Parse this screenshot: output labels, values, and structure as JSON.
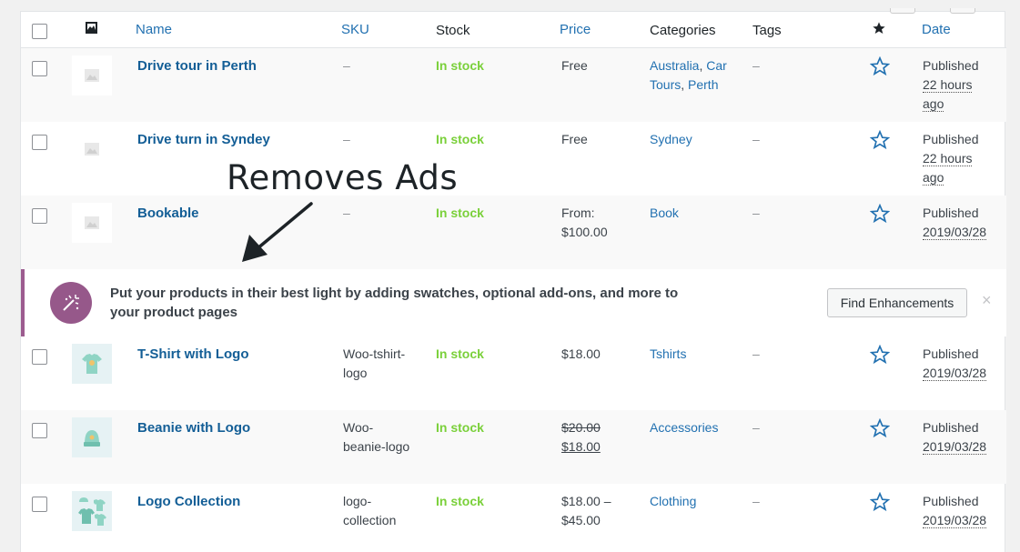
{
  "header": {
    "columns": {
      "name": "Name",
      "sku": "SKU",
      "stock": "Stock",
      "price": "Price",
      "categories": "Categories",
      "tags": "Tags",
      "date": "Date"
    },
    "icons": [
      "image-icon",
      "star-filled-icon"
    ]
  },
  "rows": [
    {
      "name": "Drive tour in Perth",
      "sku": "–",
      "stock": "In stock",
      "price_line1": "Free",
      "price_line2": "",
      "categories": [
        "Australia",
        "Car Tours",
        "Perth"
      ],
      "tags": "–",
      "status": "Published",
      "date_line1": "22 hours",
      "date_line2": "ago"
    },
    {
      "name": "Drive turn in Syndey",
      "sku": "–",
      "stock": "In stock",
      "price_line1": "Free",
      "price_line2": "",
      "categories": [
        "Sydney"
      ],
      "tags": "–",
      "status": "Published",
      "date_line1": "22 hours",
      "date_line2": "ago"
    },
    {
      "name": "Bookable",
      "sku": "–",
      "stock": "In stock",
      "price_line1": "From:",
      "price_line2": "$100.00",
      "categories": [
        "Book"
      ],
      "tags": "–",
      "status": "Published",
      "date_line1": "2019/03/28",
      "date_line2": ""
    },
    {
      "name": "T-Shirt with Logo",
      "sku_line1": "Woo-tshirt-",
      "sku_line2": "logo",
      "stock": "In stock",
      "price_line1": "$18.00",
      "price_line2": "",
      "categories": [
        "Tshirts"
      ],
      "tags": "–",
      "status": "Published",
      "date_line1": "2019/03/28",
      "date_line2": ""
    },
    {
      "name": "Beanie with Logo",
      "sku_line1": "Woo-",
      "sku_line2": "beanie-logo",
      "stock": "In stock",
      "price_line1": "$20.00",
      "price_line2": "$18.00",
      "categories": [
        "Accessories"
      ],
      "tags": "–",
      "status": "Published",
      "date_line1": "2019/03/28",
      "date_line2": ""
    },
    {
      "name": "Logo Collection",
      "sku_line1": "logo-",
      "sku_line2": "collection",
      "stock": "In stock",
      "price_line1": "$18.00 –",
      "price_line2": "$45.00",
      "categories": [
        "Clothing"
      ],
      "tags": "–",
      "status": "Published",
      "date_line1": "2019/03/28",
      "date_line2": ""
    }
  ],
  "notice": {
    "text": "Put your products in their best light by adding swatches, optional add-ons, and more to your product pages",
    "button": "Find Enhancements",
    "close": "×"
  },
  "overlay": {
    "label": "Removes Ads"
  },
  "colors": {
    "link": "#2271b1",
    "in_stock": "#7ad03a",
    "notice_accent": "#9c5c8f",
    "badge": "#96588a"
  }
}
